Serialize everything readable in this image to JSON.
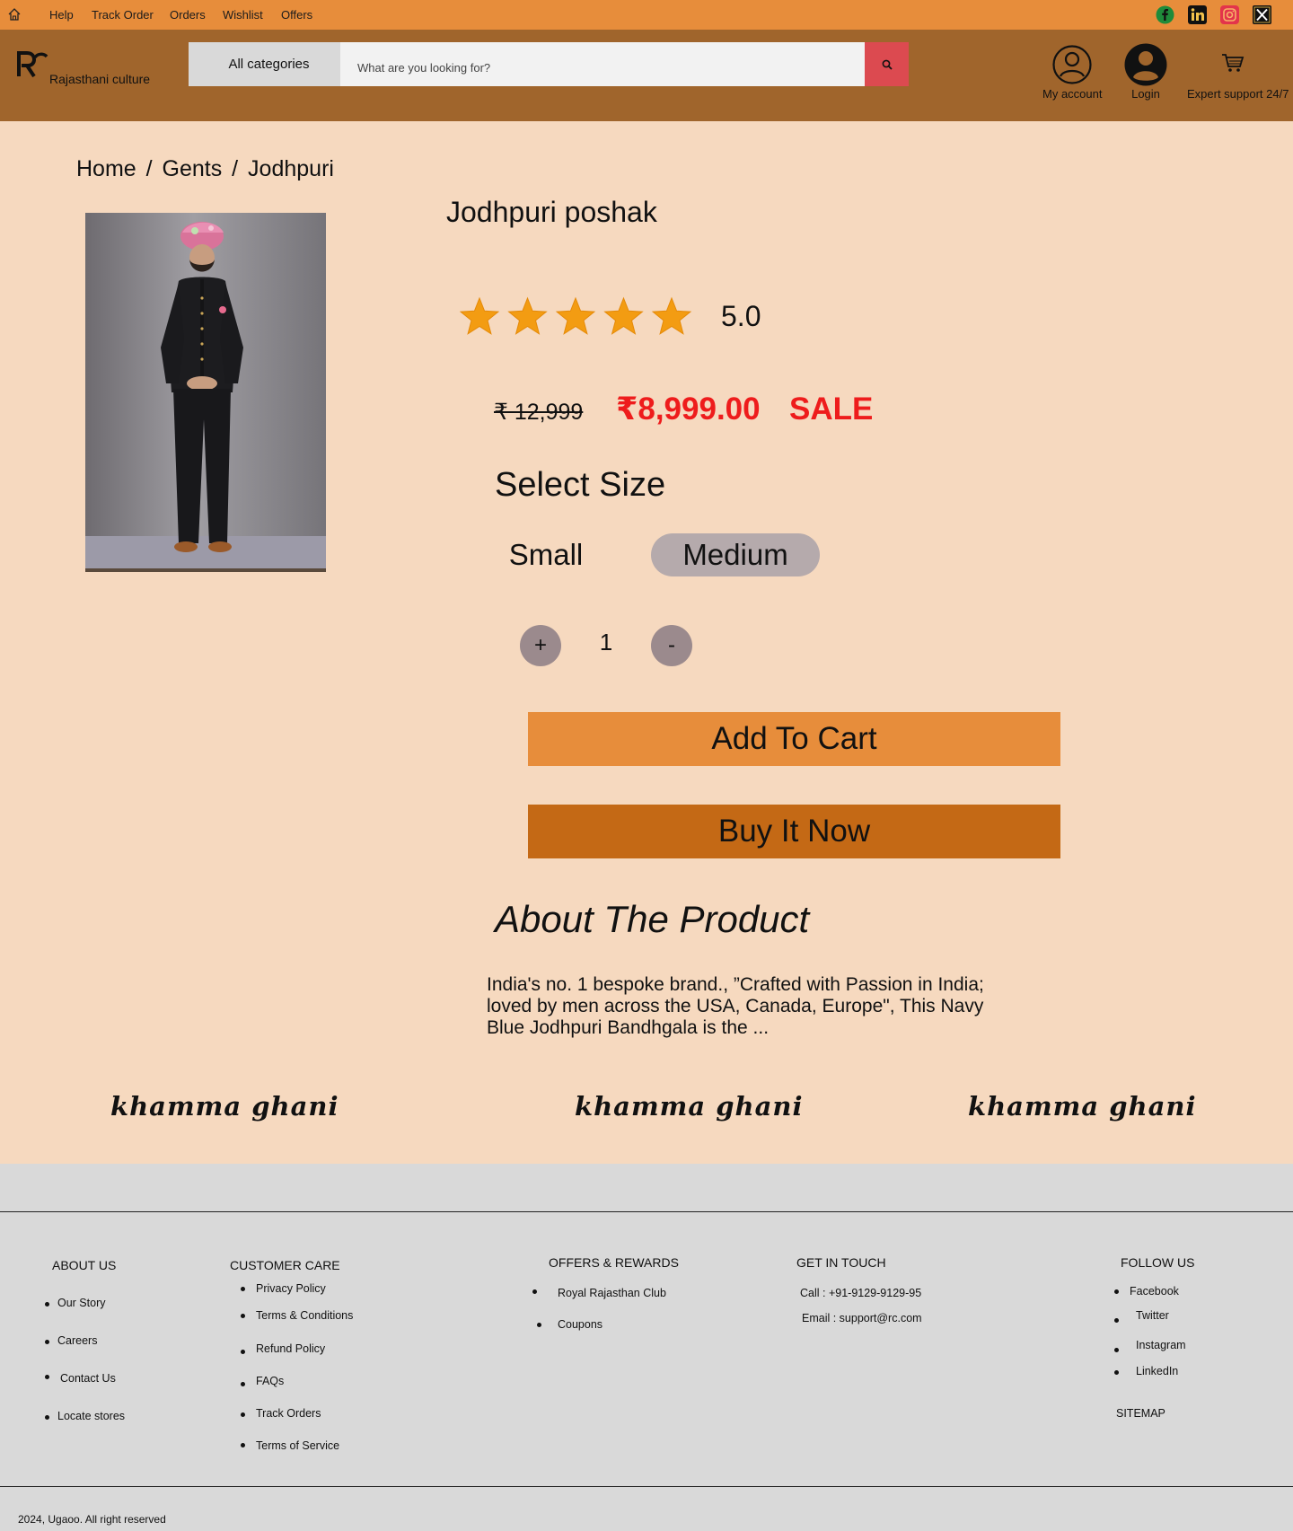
{
  "topbar": {
    "nav": [
      "Help",
      "Track Order",
      "Orders",
      "Wishlist",
      "Offers"
    ],
    "social": [
      {
        "icon": "facebook-icon",
        "color": "#1f8b3a"
      },
      {
        "icon": "linkedin-icon",
        "color": "#111111"
      },
      {
        "icon": "instagram-icon",
        "color": "#e3344b"
      },
      {
        "icon": "x-icon",
        "color": "#111111"
      }
    ]
  },
  "header": {
    "brand": "Rajasthani culture",
    "categories_label": "All categories",
    "search_placeholder": "What are you looking for?",
    "my_account": "My account",
    "login": "Login",
    "support": "Expert support 24/7"
  },
  "breadcrumb": "Home /  Gents / Jodhpuri",
  "product": {
    "title": "Jodhpuri poshak",
    "rating": "5.0",
    "stars": 5,
    "old_price": "₹  12,999",
    "price": "₹8,999.00",
    "sale": "SALE",
    "select_size_label": "Select Size",
    "sizes": [
      "Small",
      "Medium"
    ],
    "selected_size": "Medium",
    "quantity": "1",
    "plus": "+",
    "minus": "-",
    "add_to_cart": "Add To Cart",
    "buy_now": "Buy It Now",
    "about_heading": "About The Product",
    "about_text": "India's no. 1 bespoke brand., ”Crafted with Passion in India; loved by men across the USA, Canada, Europe\", This Navy Blue Jodhpuri Bandhgala is the ..."
  },
  "banner": [
    "khamma ghani",
    "khamma ghani",
    "khamma ghani"
  ],
  "footer": {
    "about": {
      "heading": "ABOUT US",
      "items": [
        "Our Story",
        "Careers",
        "Contact Us",
        "Locate stores"
      ]
    },
    "care": {
      "heading": "CUSTOMER CARE",
      "items": [
        "Privacy Policy",
        "Terms & Conditions",
        "Refund Policy",
        "FAQs",
        "Track Orders",
        "Terms of Service"
      ]
    },
    "offers": {
      "heading": "OFFERS & REWARDS",
      "items": [
        "Royal Rajasthan Club",
        "Coupons"
      ]
    },
    "contact": {
      "heading": "GET IN TOUCH",
      "call": "Call : +91-9129-9129-95",
      "email": "Email : support@rc.com"
    },
    "follow": {
      "heading": "FOLLOW US",
      "items": [
        "Facebook",
        "Twitter",
        "Instagram",
        "LinkedIn"
      ],
      "sitemap": "SITEMAP"
    },
    "copyright": "2024, Ugaoo. All right reserved"
  },
  "colors": {
    "topbar": "#e78d3b",
    "header": "#a0652c",
    "page": "#f6d9bf",
    "sale": "#ee1c1c",
    "cart_button": "#e78d3b",
    "buy_button": "#c46915",
    "footer": "#d9d9d9"
  }
}
